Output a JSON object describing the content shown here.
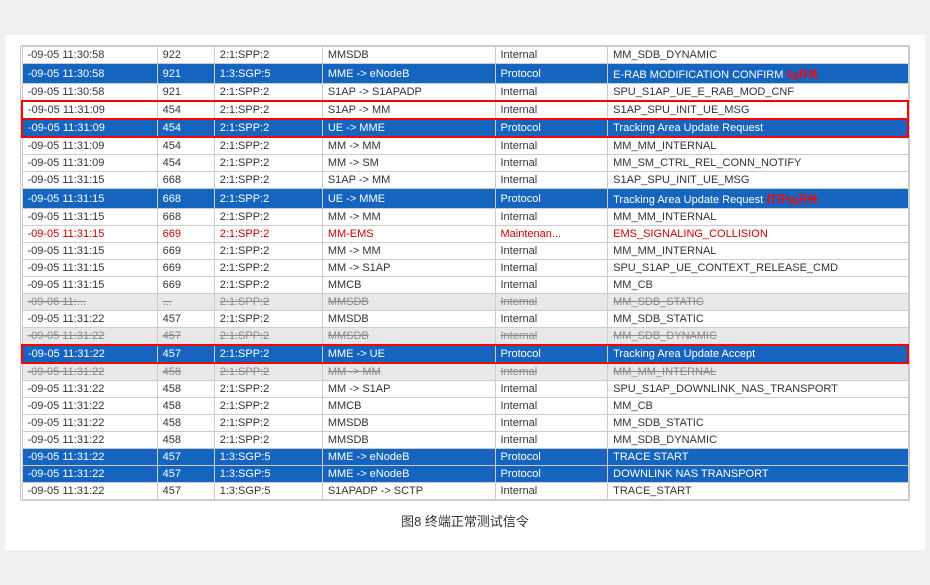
{
  "caption": "图8  终端正常测试信令",
  "table": {
    "rows": [
      {
        "time": "-09-05 11:30:58",
        "num": "922",
        "src": "2:1:SPP:2",
        "dir": "MMSDB",
        "type": "Internal",
        "msg": "MM_SDB_DYNAMIC",
        "style": "normal"
      },
      {
        "time": "-09-05 11:30:58",
        "num": "921",
        "src": "1:3:SGP:5",
        "dir": "MME -> eNodeB",
        "type": "Protocol",
        "msg": "E-RAB MODIFICATION CONFIRM",
        "style": "blue",
        "annotation": "5g开关"
      },
      {
        "time": "-09-05 11:30:58",
        "num": "921",
        "src": "2:1:SPP:2",
        "dir": "S1AP -> S1APADP",
        "type": "Internal",
        "msg": "SPU_S1AP_UE_E_RAB_MOD_CNF",
        "style": "normal"
      },
      {
        "time": "-09-05 11:31:09",
        "num": "454",
        "src": "2:1:SPP:2",
        "dir": "S1AP -> MM",
        "type": "Internal",
        "msg": "S1AP_SPU_INIT_UE_MSG",
        "style": "normal",
        "border": "red"
      },
      {
        "time": "-09-05 11:31:09",
        "num": "454",
        "src": "2:1:SPP:2",
        "dir": "UE -> MME",
        "type": "Protocol",
        "msg": "Tracking Area Update Request",
        "style": "blue",
        "border": "red"
      },
      {
        "time": "-09-05 11:31:09",
        "num": "454",
        "src": "2:1:SPP:2",
        "dir": "MM -> MM",
        "type": "Internal",
        "msg": "MM_MM_INTERNAL",
        "style": "normal"
      },
      {
        "time": "-09-05 11:31:09",
        "num": "454",
        "src": "2:1:SPP:2",
        "dir": "MM -> SM",
        "type": "Internal",
        "msg": "MM_SM_CTRL_REL_CONN_NOTIFY",
        "style": "normal"
      },
      {
        "time": "-09-05 11:31:15",
        "num": "668",
        "src": "2:1:SPP:2",
        "dir": "S1AP -> MM",
        "type": "Internal",
        "msg": "S1AP_SPU_INIT_UE_MSG",
        "style": "normal"
      },
      {
        "time": "-09-05 11:31:15",
        "num": "668",
        "src": "2:1:SPP:2",
        "dir": "UE -> MME",
        "type": "Protocol",
        "msg": "Tracking Area Update Request",
        "style": "blue",
        "annotation2": "打开5g开关"
      },
      {
        "time": "-09-05 11:31:15",
        "num": "668",
        "src": "2:1:SPP:2",
        "dir": "MM -> MM",
        "type": "Internal",
        "msg": "MM_MM_INTERNAL",
        "style": "normal"
      },
      {
        "time": "-09-05 11:31:15",
        "num": "669",
        "src": "2:1:SPP:2",
        "dir": "MM-EMS",
        "type": "Maintenan...",
        "msg": "EMS_SIGNALING_COLLISION",
        "style": "red-text"
      },
      {
        "time": "-09-05 11:31:15",
        "num": "669",
        "src": "2:1:SPP:2",
        "dir": "MM -> MM",
        "type": "Internal",
        "msg": "MM_MM_INTERNAL",
        "style": "normal"
      },
      {
        "time": "-09-05 11:31:15",
        "num": "669",
        "src": "2:1:SPP:2",
        "dir": "MM -> S1AP",
        "type": "Internal",
        "msg": "SPU_S1AP_UE_CONTEXT_RELEASE_CMD",
        "style": "normal"
      },
      {
        "time": "-09-05 11:31:15",
        "num": "669",
        "src": "2:1:SPP:2",
        "dir": "MMCB",
        "type": "Internal",
        "msg": "MM_CB",
        "style": "normal"
      },
      {
        "time": "-09-06 11:...",
        "num": "...",
        "src": "2:1:SPP:2",
        "dir": "MMSDB",
        "type": "Internal",
        "msg": "MM_SDB_STATIC",
        "style": "strike"
      },
      {
        "time": "-09-05 11:31:22",
        "num": "457",
        "src": "2:1:SPP:2",
        "dir": "MMSDB",
        "type": "Internal",
        "msg": "MM_SDB_STATIC",
        "style": "normal"
      },
      {
        "time": "-09-05 11:31:22",
        "num": "457",
        "src": "2:1:SPP:2",
        "dir": "MMSDB",
        "type": "Internal",
        "msg": "MM_SDB_DYNAMIC",
        "style": "strike"
      },
      {
        "time": "-09-05 11:31:22",
        "num": "457",
        "src": "2:1:SPP:2",
        "dir": "MME -> UE",
        "type": "Protocol",
        "msg": "Tracking Area Update Accept",
        "style": "blue",
        "border": "red"
      },
      {
        "time": "-09-05 11:31:22",
        "num": "458",
        "src": "2:1:SPP:2",
        "dir": "MM -> MM",
        "type": "Internal",
        "msg": "MM_MM_INTERNAL",
        "style": "strike"
      },
      {
        "time": "-09-05 11:31:22",
        "num": "458",
        "src": "2:1:SPP:2",
        "dir": "MM -> S1AP",
        "type": "Internal",
        "msg": "SPU_S1AP_DOWNLINK_NAS_TRANSPORT",
        "style": "normal"
      },
      {
        "time": "-09-05 11:31:22",
        "num": "458",
        "src": "2:1:SPP:2",
        "dir": "MMCB",
        "type": "Internal",
        "msg": "MM_CB",
        "style": "normal"
      },
      {
        "time": "-09-05 11:31:22",
        "num": "458",
        "src": "2:1:SPP:2",
        "dir": "MMSDB",
        "type": "Internal",
        "msg": "MM_SDB_STATIC",
        "style": "normal"
      },
      {
        "time": "-09-05 11:31:22",
        "num": "458",
        "src": "2:1:SPP:2",
        "dir": "MMSDB",
        "type": "Internal",
        "msg": "MM_SDB_DYNAMIC",
        "style": "normal"
      },
      {
        "time": "-09-05 11:31:22",
        "num": "457",
        "src": "1:3:SGP:5",
        "dir": "MME -> eNodeB",
        "type": "Protocol",
        "msg": "TRACE START",
        "style": "blue"
      },
      {
        "time": "-09-05 11:31:22",
        "num": "457",
        "src": "1:3:SGP:5",
        "dir": "MME -> eNodeB",
        "type": "Protocol",
        "msg": "DOWNLINK NAS TRANSPORT",
        "style": "blue"
      },
      {
        "time": "-09-05 11:31:22",
        "num": "457",
        "src": "1:3:SGP:5",
        "dir": "S1APADP -> SCTP",
        "type": "Internal",
        "msg": "TRACE_START",
        "style": "normal"
      }
    ]
  }
}
